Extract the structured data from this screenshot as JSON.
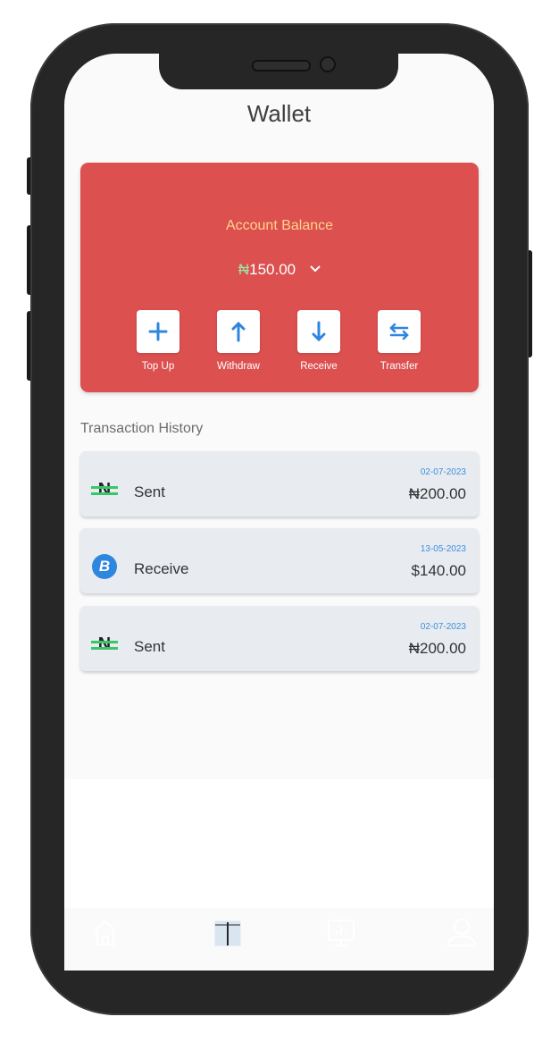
{
  "header": {
    "title": "Wallet"
  },
  "balance_card": {
    "label": "Account Balance",
    "currency_symbol": "₦",
    "amount": "150.00",
    "dropdown_icon": "chevron-down-icon",
    "actions": [
      {
        "label": "Top Up",
        "icon": "plus-icon"
      },
      {
        "label": "Withdraw",
        "icon": "arrow-up-icon"
      },
      {
        "label": "Receive",
        "icon": "arrow-down-icon"
      },
      {
        "label": "Transfer",
        "icon": "transfer-arrows-icon"
      }
    ]
  },
  "transactions": {
    "title": "Transaction History",
    "items": [
      {
        "type": "Sent",
        "date": "02-07-2023",
        "amount": "₦200.00",
        "icon": "naira-icon"
      },
      {
        "type": "Receive",
        "date": "13-05-2023",
        "amount": "$140.00",
        "icon": "bitcoin-icon"
      },
      {
        "type": "Sent",
        "date": "02-07-2023",
        "amount": "₦200.00",
        "icon": "naira-icon"
      }
    ]
  },
  "bottom_nav": {
    "items": [
      {
        "icon": "home-icon"
      },
      {
        "icon": "book-icon"
      },
      {
        "icon": "monitor-chart-icon"
      },
      {
        "icon": "user-icon"
      }
    ]
  },
  "colors": {
    "card": "#dc5050",
    "accent_blue": "#2f86de",
    "balance_label": "#ffd38a",
    "naira_green": "#39c66a"
  }
}
